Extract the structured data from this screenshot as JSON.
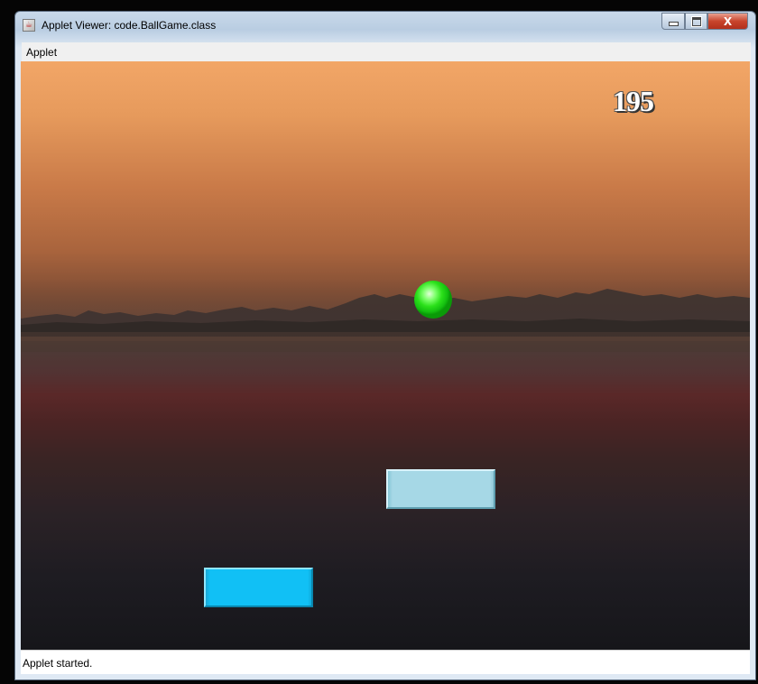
{
  "window": {
    "title": "Applet Viewer: code.BallGame.class",
    "icon": "java-applet-icon"
  },
  "window_controls": {
    "minimize_icon": "minimize-icon",
    "maximize_icon": "maximize-icon",
    "close_label": "X"
  },
  "menubar": {
    "items": [
      {
        "label": "Applet"
      }
    ]
  },
  "game": {
    "score": "195",
    "ball_color": "#22dd11",
    "paddle_top_color": "#a6d8e6",
    "paddle_bottom_color": "#11c0f5",
    "background": "sunset-horizon"
  },
  "statusbar": {
    "text": "Applet started."
  }
}
